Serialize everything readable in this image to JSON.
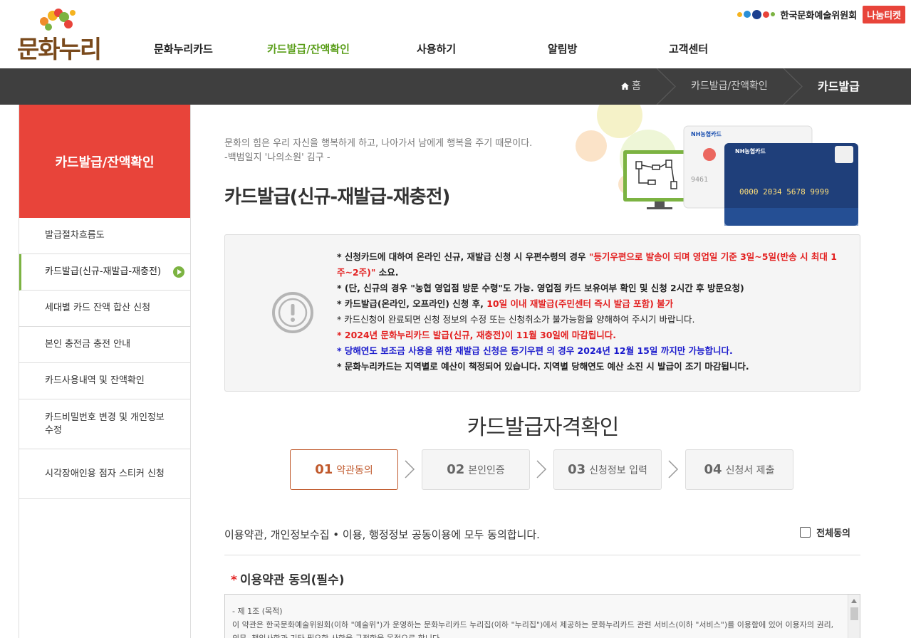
{
  "header": {
    "logo_text": "문화누리",
    "nav": [
      "문화누리카드",
      "카드발급/잔액확인",
      "사용하기",
      "알림방",
      "고객센터"
    ],
    "arko_label": "한국문화예술위원회",
    "nanum_label": "나눔티켓"
  },
  "breadcrumb": {
    "home": "홈",
    "level1": "카드발급/잔액확인",
    "current": "카드발급"
  },
  "sidebar": {
    "title": "카드발급/잔액확인",
    "items": [
      {
        "label": "발급절차흐름도"
      },
      {
        "label": "카드발급(신규-재발급-재충전)"
      },
      {
        "label": "세대별 카드 잔액 합산 신청"
      },
      {
        "label": "본인 충전금 충전 안내"
      },
      {
        "label": "카드사용내역 및 잔액확인"
      },
      {
        "label": "카드비밀번호 변경 및 개인정보수정"
      },
      {
        "label": "시각장애인용 점자 스티커 신청"
      }
    ]
  },
  "main": {
    "quote_line1": "문화의 힘은 우리 자신을 행복하게 하고, 나아가서 남에게 행복을 주기 때문이다.",
    "quote_line2": "-백범일지 '나의소원' 김구 -",
    "title": "카드발급(신규-재발급-재충전)",
    "card_front_number": "0000 2034 5678 9999",
    "card_back_number": "9461",
    "notice": {
      "l1a": "* 신청카드에 대하여 온라인 신규, 재발급 신청 시 우편수령의 경우 ",
      "l1b": "\"등기우편으로 발송이 되며 영업일 기준 3일~5일(반송 시 최대 1주~2주)\"",
      "l1c": " 소요.",
      "l2": "* (단, 신규의 경우 \"농협 영업점 방문 수령\"도 가능. 영업점 카드 보유여부 확인 및 신청 2시간 후 방문요청)",
      "l3a": "* 카드발급(온라인, 오프라인) 신청 후, ",
      "l3b": "10일 이내 재발급(주민센터 즉시 발급 포함) 불가",
      "l4": "* 카드신청이 완료되면 신청 정보의 수정 또는 신청취소가 불가능함을 양해하여 주시기 바랍니다.",
      "l5": "* 2024년 문화누리카드 발급(신규, 재충전)이 11월 30일에 마감됩니다.",
      "l6": "* 당해연도 보조금 사용을 위한 재발급 신청은 등기우편 의 경우 2024년 12월 15일 까지만 가능합니다.",
      "l7": "* 문화누리카드는 지역별로 예산이 책정되어 있습니다. 지역별 당해연도 예산 소진 시 발급이 조기 마감됩니다."
    },
    "section_title": "카드발급자격확인",
    "steps": [
      {
        "num": "01",
        "label": "약관동의"
      },
      {
        "num": "02",
        "label": "본인인증"
      },
      {
        "num": "03",
        "label": "신청정보 입력"
      },
      {
        "num": "04",
        "label": "신청서 제출"
      }
    ],
    "agree_text": "이용약관, 개인정보수집 • 이용, 행정정보 공동이용에 모두 동의합니다.",
    "agree_all_label": "전체동의",
    "terms_title": "이용약관 동의(필수)",
    "terms_star": "*",
    "terms_line1": "- 제 1조 (목적)",
    "terms_line2": "이 약관은 한국문화예술위원회(이하 \"예술위\")가 운영하는 문화누리카드 누리집(이하 \"누리집\")에서 제공하는 문화누리카드 관련 서비스(이하 \"서비스\")를 이용함에 있어 이용자의 권리, 의무, 책임사항과 기타 필요한 사항을 규정함을 목적으로 합니다."
  }
}
